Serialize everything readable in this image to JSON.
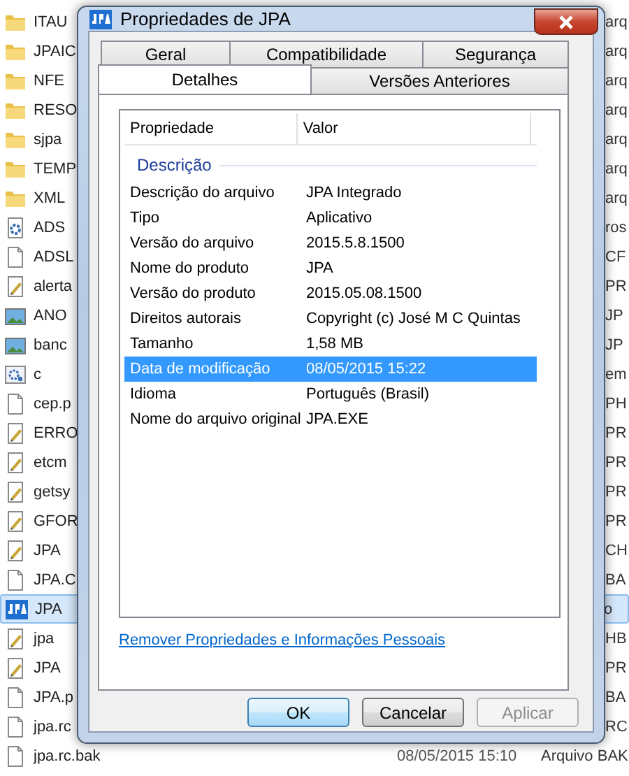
{
  "explorer": {
    "rows": [
      {
        "name": "ITAU",
        "type": "arq",
        "kind": "folder",
        "selected": false
      },
      {
        "name": "JPAIC",
        "type": "arq",
        "kind": "folder",
        "selected": false
      },
      {
        "name": "NFE",
        "type": "arq",
        "kind": "folder",
        "selected": false
      },
      {
        "name": "RESO",
        "type": "arq",
        "kind": "folder",
        "selected": false
      },
      {
        "name": "sjpa",
        "type": "arq",
        "kind": "folder",
        "selected": false
      },
      {
        "name": "TEMP",
        "type": "arq",
        "kind": "folder",
        "selected": false
      },
      {
        "name": "XML",
        "type": "arq",
        "kind": "folder",
        "selected": false
      },
      {
        "name": "ADS",
        "type": "ros",
        "kind": "gear",
        "selected": false
      },
      {
        "name": "ADSL",
        "type": "CF",
        "kind": "file",
        "selected": false
      },
      {
        "name": "alerta",
        "type": "PR",
        "kind": "script",
        "selected": false
      },
      {
        "name": "ANO",
        "type": "JP",
        "kind": "image",
        "selected": false
      },
      {
        "name": "banc",
        "type": "JP",
        "kind": "image",
        "selected": false
      },
      {
        "name": "c",
        "type": "em",
        "kind": "settings",
        "selected": false
      },
      {
        "name": "cep.p",
        "type": "PH",
        "kind": "file",
        "selected": false
      },
      {
        "name": "ERRO",
        "type": "PR",
        "kind": "script",
        "selected": false
      },
      {
        "name": "etcm",
        "type": "PR",
        "kind": "script",
        "selected": false
      },
      {
        "name": "getsy",
        "type": "PR",
        "kind": "script",
        "selected": false
      },
      {
        "name": "GFOR",
        "type": "PR",
        "kind": "script",
        "selected": false
      },
      {
        "name": "JPA",
        "type": "CH",
        "kind": "script",
        "selected": false
      },
      {
        "name": "JPA.C",
        "type": "BA",
        "kind": "file",
        "selected": false
      },
      {
        "name": "JPA",
        "type": "o",
        "kind": "app",
        "selected": true
      },
      {
        "name": "jpa",
        "type": "HB",
        "kind": "script",
        "selected": false
      },
      {
        "name": "JPA",
        "type": "PR",
        "kind": "script",
        "selected": false
      },
      {
        "name": "JPA.p",
        "type": "BA",
        "kind": "file",
        "selected": false
      },
      {
        "name": "jpa.rc",
        "type": "RC",
        "kind": "file",
        "selected": false
      },
      {
        "name": "jpa.rc.bak",
        "date": "08/05/2015 15:10",
        "type": "Arquivo BAK",
        "kind": "file",
        "selected": false
      }
    ]
  },
  "dialog": {
    "title": "Propriedades de JPA",
    "tab_rows": [
      [
        {
          "label": "Geral",
          "selected": false
        },
        {
          "label": "Compatibilidade",
          "selected": false
        },
        {
          "label": "Segurança",
          "selected": false
        }
      ],
      [
        {
          "label": "Detalhes",
          "selected": true
        },
        {
          "label": "Versões Anteriores",
          "selected": false
        }
      ]
    ],
    "columns": [
      "Propriedade",
      "Valor"
    ],
    "group": "Descrição",
    "properties": [
      {
        "name": "Descrição do arquivo",
        "value": "JPA Integrado",
        "selected": false
      },
      {
        "name": "Tipo",
        "value": "Aplicativo",
        "selected": false
      },
      {
        "name": "Versão do arquivo",
        "value": "2015.5.8.1500",
        "selected": false
      },
      {
        "name": "Nome do produto",
        "value": "JPA",
        "selected": false
      },
      {
        "name": "Versão do produto",
        "value": "2015.05.08.1500",
        "selected": false
      },
      {
        "name": "Direitos autorais",
        "value": "Copyright (c) José M C Quintas",
        "selected": false
      },
      {
        "name": "Tamanho",
        "value": "1,58 MB",
        "selected": false
      },
      {
        "name": "Data de modificação",
        "value": "08/05/2015 15:22",
        "selected": true
      },
      {
        "name": "Idioma",
        "value": "Português (Brasil)",
        "selected": false
      },
      {
        "name": "Nome do arquivo original",
        "value": "JPA.EXE",
        "selected": false
      }
    ],
    "link": "Remover Propriedades e Informações Pessoais",
    "buttons": [
      {
        "label": "OK",
        "kind": "default"
      },
      {
        "label": "Cancelar",
        "kind": "normal"
      },
      {
        "label": "Aplicar",
        "kind": "disabled"
      }
    ]
  }
}
